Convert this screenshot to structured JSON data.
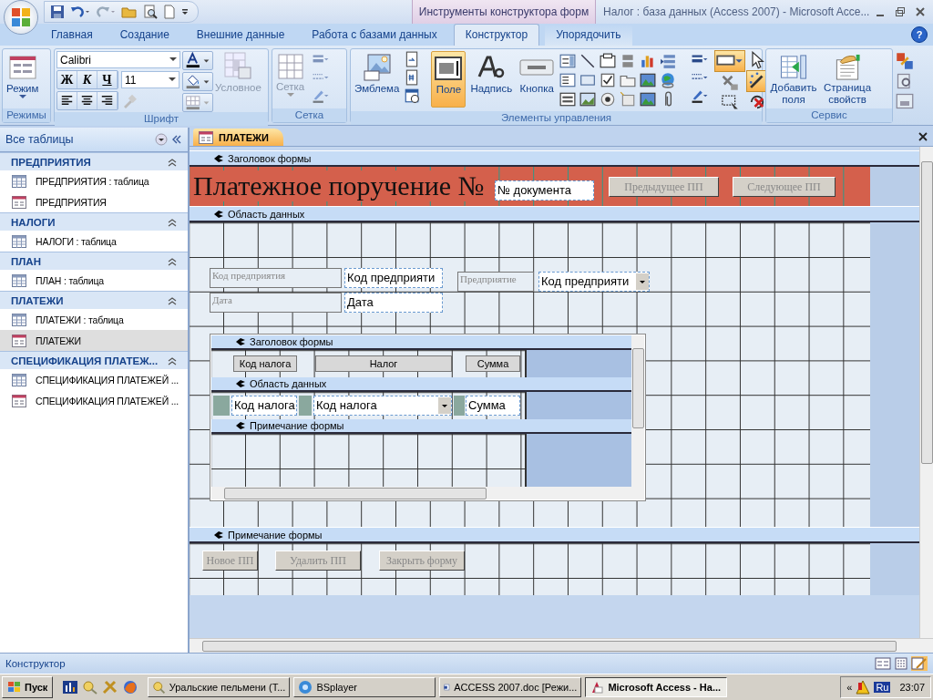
{
  "window": {
    "title": "Налог : база данных (Access 2007)  - Microsoft Acce...",
    "context_tab": "Инструменты конструктора форм",
    "help": "?"
  },
  "tabs": [
    {
      "label": "Главная",
      "selected": false
    },
    {
      "label": "Создание",
      "selected": false
    },
    {
      "label": "Внешние данные",
      "selected": false
    },
    {
      "label": "Работа с базами данных",
      "selected": false
    },
    {
      "label": "Конструктор",
      "selected": true
    },
    {
      "label": "Упорядочить",
      "selected": false
    }
  ],
  "ribbon": {
    "modes": {
      "label": "Режимы",
      "button": "Режим"
    },
    "font": {
      "label": "Шрифт",
      "font_name": "Calibri",
      "font_size": "11",
      "bold": "Ж",
      "italic": "К",
      "underline": "Ч",
      "conditional": "Условное"
    },
    "grid": {
      "label": "Сетка",
      "button": "Сетка"
    },
    "controls": {
      "label": "Элементы управления",
      "buttons": [
        {
          "label": "Эмблема",
          "selected": false
        },
        {
          "label": "Поле",
          "selected": true
        },
        {
          "label": "Надпись",
          "selected": false
        },
        {
          "label": "Кнопка",
          "selected": false
        }
      ],
      "shape_tool_pressed": true,
      "wizards_on": true
    },
    "service": {
      "label": "Сервис",
      "buttons": [
        "Добавить поля",
        "Страница свойств"
      ]
    }
  },
  "navigation": {
    "title": "Все таблицы",
    "groups": [
      {
        "title": "ПРЕДПРИЯТИЯ",
        "items": [
          {
            "label": "ПРЕДПРИЯТИЯ : таблица",
            "kind": "table",
            "selected": false
          },
          {
            "label": "ПРЕДПРИЯТИЯ",
            "kind": "form",
            "selected": false
          }
        ]
      },
      {
        "title": "НАЛОГИ",
        "items": [
          {
            "label": "НАЛОГИ : таблица",
            "kind": "table",
            "selected": false
          }
        ]
      },
      {
        "title": "ПЛАН",
        "items": [
          {
            "label": "ПЛАН : таблица",
            "kind": "table",
            "selected": false
          }
        ]
      },
      {
        "title": "ПЛАТЕЖИ",
        "items": [
          {
            "label": "ПЛАТЕЖИ : таблица",
            "kind": "table",
            "selected": false
          },
          {
            "label": "ПЛАТЕЖИ",
            "kind": "form",
            "selected": true
          }
        ]
      },
      {
        "title": "СПЕЦИФИКАЦИЯ ПЛАТЕЖ...",
        "items": [
          {
            "label": "СПЕЦИФИКАЦИЯ ПЛАТЕЖЕЙ ...",
            "kind": "table",
            "selected": false
          },
          {
            "label": "СПЕЦИФИКАЦИЯ ПЛАТЕЖЕЙ ...",
            "kind": "form",
            "selected": false
          }
        ]
      }
    ]
  },
  "document": {
    "tab": "ПЛАТЕЖИ",
    "header": {
      "band": "Заголовок формы",
      "title": "Платежное поручение №",
      "controls": [
        {
          "kind": "textbox",
          "text": "№ документа"
        },
        {
          "kind": "button",
          "text": "Предыдущее ПП"
        },
        {
          "kind": "button",
          "text": "Следующее ПП"
        }
      ]
    },
    "detail": {
      "band": "Область данных",
      "controls": [
        {
          "kind": "label",
          "text": "Код предприятия"
        },
        {
          "kind": "textbox",
          "text": "Код предприяти"
        },
        {
          "kind": "label",
          "text": "Предприятие"
        },
        {
          "kind": "combo",
          "text": "Код предприяти"
        },
        {
          "kind": "label",
          "text": "Дата"
        },
        {
          "kind": "textbox",
          "text": "Дата"
        }
      ]
    },
    "subform": {
      "header_band": "Заголовок формы",
      "header_controls": [
        {
          "kind": "label",
          "text": "Код налога"
        },
        {
          "kind": "label",
          "text": "Налог"
        },
        {
          "kind": "label",
          "text": "Сумма"
        }
      ],
      "detail_band": "Область данных",
      "detail_controls": [
        {
          "kind": "textbox",
          "text": "Код налога"
        },
        {
          "kind": "combo",
          "text": "Код налога"
        },
        {
          "kind": "textbox",
          "text": "Сумма"
        }
      ],
      "footer_band": "Примечание формы"
    },
    "footer": {
      "band": "Примечание формы",
      "controls": [
        {
          "kind": "button",
          "text": "Новое ПП"
        },
        {
          "kind": "button",
          "text": "Удалить ПП"
        },
        {
          "kind": "button",
          "text": "Закрыть форму"
        }
      ]
    }
  },
  "status_bar": {
    "text": "Конструктор"
  },
  "taskbar": {
    "start": "Пуск",
    "tasks": [
      {
        "label": "Уральские пельмени (Т...",
        "selected": false
      },
      {
        "label": "BSplayer",
        "selected": false
      },
      {
        "label": "ACCESS 2007.doc [Режи...",
        "selected": false
      },
      {
        "label": "Microsoft Access - На...",
        "selected": true
      }
    ],
    "tray_expand": "«",
    "language": "Ru",
    "clock": "23:07"
  }
}
